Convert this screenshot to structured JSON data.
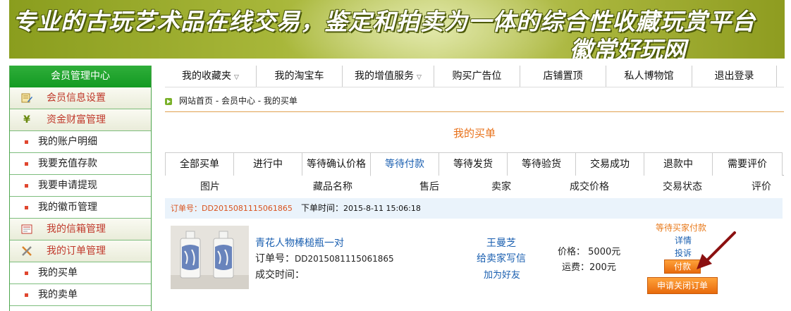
{
  "banner": {
    "line1": "专业的古玩艺术品在线交易，鉴定和拍卖为一体的综合性收藏玩赏平台",
    "line2": "徽常好玩网"
  },
  "sidebar": {
    "title": "会员管理中心",
    "items": [
      {
        "label": "会员信息设置",
        "type": "category",
        "icon": "edit-note-icon"
      },
      {
        "label": "资金财富管理",
        "type": "category",
        "icon": "yen-icon"
      },
      {
        "label": "我的账户明细",
        "type": "link"
      },
      {
        "label": "我要充值存款",
        "type": "link"
      },
      {
        "label": "我要申请提现",
        "type": "link"
      },
      {
        "label": "我的徽币管理",
        "type": "link"
      },
      {
        "label": "我的信箱管理",
        "type": "category",
        "icon": "mailbox-icon"
      },
      {
        "label": "我的订单管理",
        "type": "category",
        "icon": "tools-icon"
      },
      {
        "label": "我的买单",
        "type": "link"
      },
      {
        "label": "我的卖单",
        "type": "link"
      }
    ]
  },
  "topnav": {
    "items": [
      {
        "label": "我的收藏夹",
        "dropdown": true
      },
      {
        "label": "我的淘宝车",
        "dropdown": false
      },
      {
        "label": "我的增值服务",
        "dropdown": true
      },
      {
        "label": "购买广告位",
        "dropdown": false
      },
      {
        "label": "店铺置顶",
        "dropdown": false
      },
      {
        "label": "私人博物馆",
        "dropdown": false
      },
      {
        "label": "退出登录",
        "dropdown": false
      }
    ],
    "arrow": "▽"
  },
  "breadcrumb": "网站首页 - 会员中心 - 我的买单",
  "page_title": "我的买单",
  "tabs": [
    "全部买单",
    "进行中",
    "等待确认价格",
    "等待付款",
    "等待发货",
    "等待验货",
    "交易成功",
    "退款中",
    "需要评价"
  ],
  "active_tab": "等待付款",
  "columns": [
    "图片",
    "藏品名称",
    "售后",
    "卖家",
    "成交价格",
    "交易状态",
    "评价"
  ],
  "order": {
    "order_no_label": "订单号：",
    "order_no": "DD2015081115061865",
    "order_time_label": "下单时间：",
    "order_time": "2015-8-11 15:06:18",
    "item_name": "青花人物棒槌瓶一对",
    "item_no_label": "订单号：",
    "item_no": "DD2015081115061865",
    "deal_time_label": "成交时间：",
    "seller": "王曼芝",
    "write_seller": "给卖家写信",
    "add_friend": "加为好友",
    "price_label": "价格：",
    "price": "5000元",
    "freight_label": "运费：",
    "freight": "200元",
    "status": "等待买家付款",
    "detail": "详情",
    "complain": "投诉",
    "pay_button": "付款",
    "close_button": "申请关闭订单"
  },
  "colors": {
    "accent_orange": "#e87a1c",
    "link_blue": "#1a5fb0",
    "sidebar_green": "#139a22",
    "annotation_arrow": "#8b1010"
  }
}
